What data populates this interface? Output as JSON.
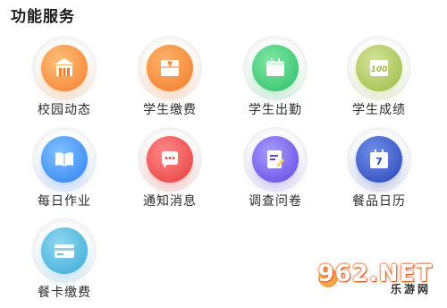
{
  "section": {
    "title": "功能服务"
  },
  "services": [
    {
      "id": "school-news",
      "label": "校园动态",
      "icon": "school-building-icon",
      "color": "#f47d2c"
    },
    {
      "id": "student-payment",
      "label": "学生缴费",
      "icon": "payment-yen-icon",
      "color": "#f07a2a"
    },
    {
      "id": "attendance",
      "label": "学生出勤",
      "icon": "calendar-check-icon",
      "color": "#2cbf66"
    },
    {
      "id": "grades",
      "label": "学生成绩",
      "icon": "score-100-icon",
      "color": "#9cbb42"
    },
    {
      "id": "homework",
      "label": "每日作业",
      "icon": "open-book-icon",
      "color": "#2e7ff0"
    },
    {
      "id": "notices",
      "label": "通知消息",
      "icon": "chat-bubble-icon",
      "color": "#e63a3a"
    },
    {
      "id": "survey",
      "label": "调查问卷",
      "icon": "edit-document-icon",
      "color": "#6246e0"
    },
    {
      "id": "meal-calendar",
      "label": "餐品日历",
      "icon": "calendar-day-icon",
      "color": "#2945b8"
    },
    {
      "id": "card-payment",
      "label": "餐卡缴费",
      "icon": "bank-card-icon",
      "color": "#39a8d6"
    }
  ],
  "calendar_day": "7",
  "score_text": "100",
  "watermark": {
    "text": "962.NET",
    "subtext": "乐游网"
  }
}
